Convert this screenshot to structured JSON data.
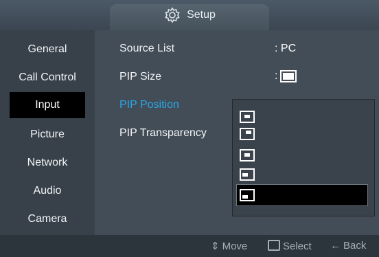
{
  "window": {
    "title": "Setup"
  },
  "sidebar": {
    "items": [
      {
        "label": "General"
      },
      {
        "label": "Call Control"
      },
      {
        "label": "Input"
      },
      {
        "label": "Picture"
      },
      {
        "label": "Network"
      },
      {
        "label": "Audio"
      },
      {
        "label": "Camera"
      }
    ],
    "active_index": 2
  },
  "settings": [
    {
      "label": "Source List",
      "value": ": PC"
    },
    {
      "label": "PIP Size",
      "value": ":"
    },
    {
      "label": "PIP Position",
      "value": ""
    },
    {
      "label": "PIP Transparency",
      "value": ""
    }
  ],
  "pip_position_options": {
    "icon_names": [
      "pip-top-left-icon",
      "pip-top-right-icon",
      "pip-center-icon",
      "pip-bottom-right-icon",
      "pip-bottom-left-icon"
    ],
    "selected_index": 4
  },
  "footer": {
    "move_label": "Move",
    "select_label": "Select",
    "back_label": "Back"
  },
  "colors": {
    "selected_text": "#29a8e8",
    "active_bg": "#000000"
  }
}
